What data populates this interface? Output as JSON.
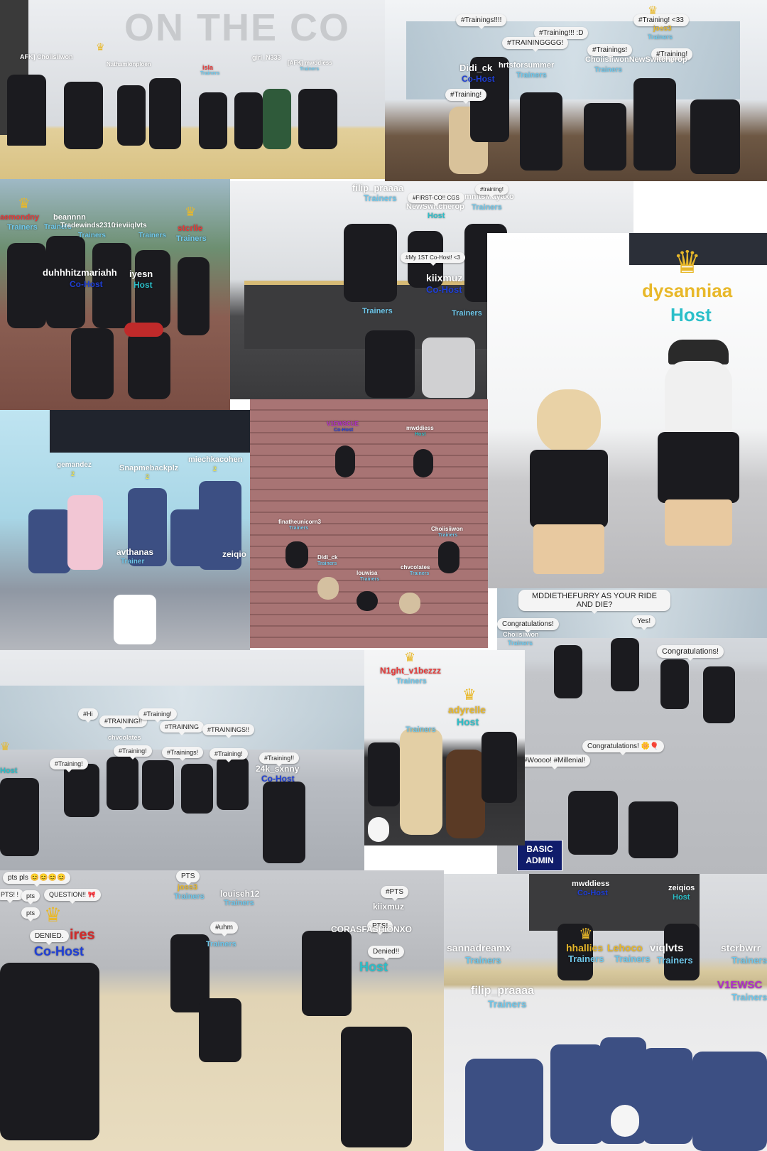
{
  "colors": {
    "trainers": "#6fc7ea",
    "host": "#2bbfc9",
    "cohost": "#1f3fd6",
    "crown": "#e8b82a",
    "suit": "#1b1b1f",
    "skin": "#e8c9a0"
  },
  "p1": {
    "wall_text": "ON THE CO",
    "labels": [
      {
        "name": "AFK] Choiisiiwon",
        "role": ""
      },
      {
        "name": "Nathamionploen",
        "role": ""
      },
      {
        "name": "girl_N333",
        "role": ""
      },
      {
        "name": "isla",
        "role": "Trainers"
      },
      {
        "name": "[AFK] mwddiess",
        "role": "Trainers"
      }
    ]
  },
  "p2": {
    "bubbles": [
      "#Trainings!!!!",
      "#Training!!! :D",
      "#TRAININGGGG!",
      "#Training! <33",
      "#Trainings!",
      "#Training!",
      "#Training!"
    ],
    "names": [
      {
        "name": "Didi_ck",
        "role": "Co-Host"
      },
      {
        "name": "hrtsforsummer",
        "role": "Trainers"
      },
      {
        "name": "ChoiisiiwonNewSwitcherop",
        "role": "Trainers"
      },
      {
        "name": "joss3",
        "role": "Trainers"
      }
    ]
  },
  "p3": {
    "names": [
      {
        "name": "aemondny",
        "role": "Trainers"
      },
      {
        "name": "beannnn",
        "role": "Trainers"
      },
      {
        "name": "Tradewinds2310",
        "role": "Trainers"
      },
      {
        "name": "rieviiqlvts",
        "role": "Trainers"
      },
      {
        "name": "stcrlle",
        "role": "Trainers"
      },
      {
        "name": "duhhhitzmariahh",
        "role": "Co-Host"
      },
      {
        "name": "iyesn",
        "role": "Host"
      }
    ]
  },
  "p4": {
    "names": [
      {
        "name": "filip_praaaa",
        "role": "Trainers"
      },
      {
        "name": "NewSwitcherop",
        "role": "Host"
      },
      {
        "name": "mnitsMayaxo",
        "role": "Trainers"
      },
      {
        "name": "kiixmuz",
        "role": "Co-Host"
      },
      {
        "name": "#Kiimu",
        "role": "Trainers"
      },
      {
        "name": "#Trainin",
        "role": "Trainers"
      }
    ],
    "bubbles": [
      "#FIRST-CO!! CGS",
      "#training!",
      "#My 1ST Co-Host! <3"
    ]
  },
  "p5": {
    "name": "dysanniaa",
    "role": "Host"
  },
  "p6": {
    "names": [
      {
        "name": "gemandez",
        "rank": "2"
      },
      {
        "name": "Snapmebackplz",
        "rank": "2"
      },
      {
        "name": "miechkacohen",
        "rank": "2"
      },
      {
        "name": "avthanas",
        "rank": "Trainer"
      },
      {
        "name": "zeiqio",
        "rank": ""
      }
    ]
  },
  "p7": {
    "names": [
      {
        "name": "V1EWSCUE",
        "role": "Co-Host"
      },
      {
        "name": "mwddiess",
        "role": "Host"
      },
      {
        "name": "finatheunicorn3",
        "role": "Trainers"
      },
      {
        "name": "Choiisiiwon",
        "role": "Trainers"
      },
      {
        "name": "Didi_ck",
        "role": "Trainers"
      },
      {
        "name": "louwisa",
        "role": "Trainers"
      },
      {
        "name": "chvcolates",
        "role": "Trainers"
      }
    ]
  },
  "p8": {
    "bubbles": [
      "MDDIETHEFURRY AS YOUR RIDE AND DIE?",
      "Congratulations!",
      "Yes!",
      "Congratulations!",
      "Congratulations! 🌼🎈",
      "#Woooo! #Millenial!"
    ],
    "names": [
      {
        "name": "Choiisiiwon",
        "role": "Trainers"
      }
    ],
    "admin": "BASIC ADMIN"
  },
  "p9": {
    "bubbles": [
      "#Hi",
      "#TRAINING!!",
      "#Training!",
      "#TRAINING",
      "#TRAININGS!!",
      "#Training!",
      "#Trainings!",
      "#Training!",
      "#Training!!",
      "#Training!"
    ],
    "names": [
      {
        "name": "chvcolates",
        "role": "Trainers"
      },
      {
        "name": "24k_sxnny",
        "role": "Co-Host"
      },
      {
        "name": "Host",
        "role": "Host"
      }
    ]
  },
  "p10": {
    "names": [
      {
        "name": "N1ght_v1bezzz",
        "role": "Trainers"
      },
      {
        "name": "adyrelle",
        "role": "Host"
      },
      {
        "name": "Host",
        "role": "Trainers"
      }
    ]
  },
  "p11": {
    "bubbles": [
      "pts pls 😊😊😊😊",
      "PTS! !",
      "pts",
      "QUESTION!! 🎀",
      "pts",
      "DENIED.",
      "PTS",
      "#uhm",
      "PTS!",
      "#PTS",
      "Denied!!"
    ],
    "names": [
      {
        "name": "joss3",
        "role": "Trainers"
      },
      {
        "name": "louiseh12",
        "role": "Trainers"
      },
      {
        "name": "kiixmuz",
        "role": "Trainers"
      },
      {
        "name": "CORASFASHIONXO",
        "role": "Host"
      },
      {
        "name": "ires",
        "role": "Co-Host"
      }
    ]
  },
  "p12": {
    "names": [
      {
        "name": "mwddiess",
        "role": "Co-Host"
      },
      {
        "name": "zeiqios",
        "role": "Host"
      },
      {
        "name": "sannadreamx",
        "role": "Trainers"
      },
      {
        "name": "hhallies",
        "role": "Trainers"
      },
      {
        "name": "Lehoco",
        "role": "Trainers"
      },
      {
        "name": "viqlvts",
        "role": "Trainers"
      },
      {
        "name": "stcrbwrr",
        "role": "Trainers"
      },
      {
        "name": "V1EWSC",
        "role": "Trainers"
      },
      {
        "name": "filip_praaaa",
        "role": "Trainers"
      }
    ]
  }
}
